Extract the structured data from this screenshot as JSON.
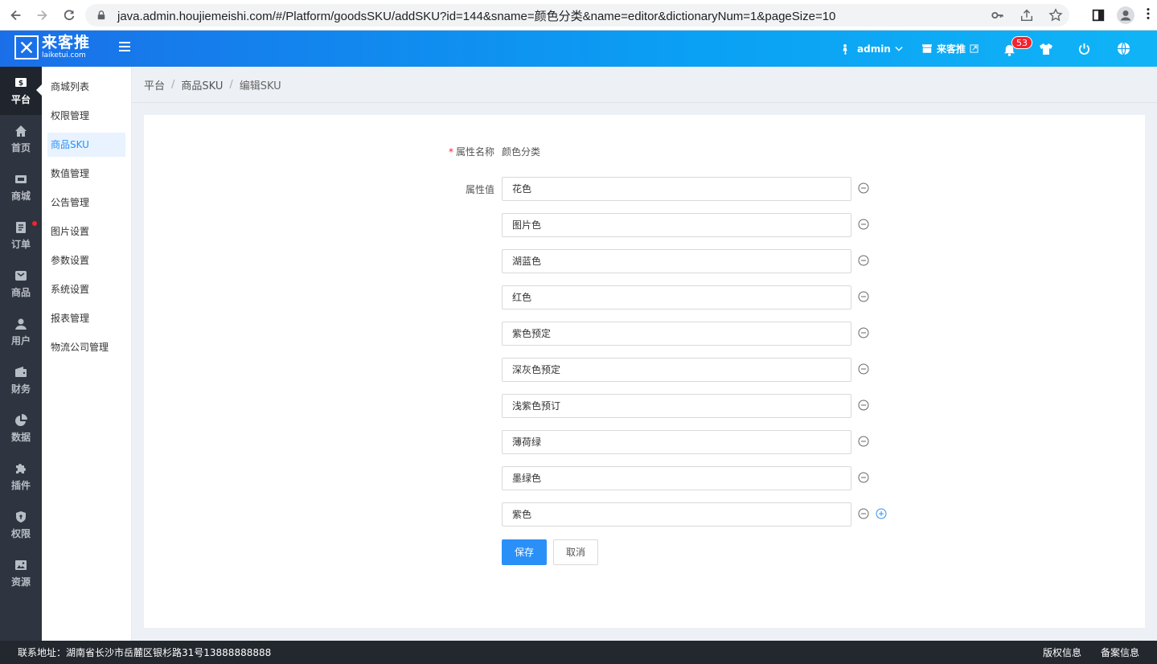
{
  "browser": {
    "url": "java.admin.houjiemeishi.com/#/Platform/goodsSKU/addSKU?id=144&sname=颜色分类&name=editor&dictionaryNum=1&pageSize=10"
  },
  "header": {
    "logo_main": "来客推",
    "logo_sub": "laiketui.com",
    "user": "admin",
    "store": "来客推",
    "notification_count": "53"
  },
  "rail": [
    {
      "label": "平台",
      "icon": "platform-icon"
    },
    {
      "label": "首页",
      "icon": "home-icon"
    },
    {
      "label": "商城",
      "icon": "mall-icon"
    },
    {
      "label": "订单",
      "icon": "order-icon"
    },
    {
      "label": "商品",
      "icon": "goods-icon"
    },
    {
      "label": "用户",
      "icon": "user-icon"
    },
    {
      "label": "财务",
      "icon": "wallet-icon"
    },
    {
      "label": "数据",
      "icon": "pie-icon"
    },
    {
      "label": "插件",
      "icon": "puzzle-icon"
    },
    {
      "label": "权限",
      "icon": "shield-icon"
    },
    {
      "label": "资源",
      "icon": "image-icon"
    }
  ],
  "submenu": [
    "商城列表",
    "权限管理",
    "商品SKU",
    "数值管理",
    "公告管理",
    "图片设置",
    "参数设置",
    "系统设置",
    "报表管理",
    "物流公司管理"
  ],
  "breadcrumb": [
    "平台",
    "商品SKU",
    "编辑SKU"
  ],
  "form": {
    "name_label": "属性名称",
    "name_value": "颜色分类",
    "values_label": "属性值",
    "values": [
      "花色",
      "图片色",
      "湖蓝色",
      "红色",
      "紫色预定",
      "深灰色预定",
      "浅紫色预订",
      "薄荷绿",
      "墨绿色",
      "紫色"
    ],
    "save_label": "保存",
    "cancel_label": "取消"
  },
  "footer": {
    "address": "联系地址：湖南省长沙市岳麓区银杉路31号13888888888",
    "copyright": "版权信息",
    "record": "备案信息"
  },
  "colors": {
    "primary": "#2a90f7",
    "rail_bg": "#2e3440",
    "footer_bg": "#23272e"
  }
}
